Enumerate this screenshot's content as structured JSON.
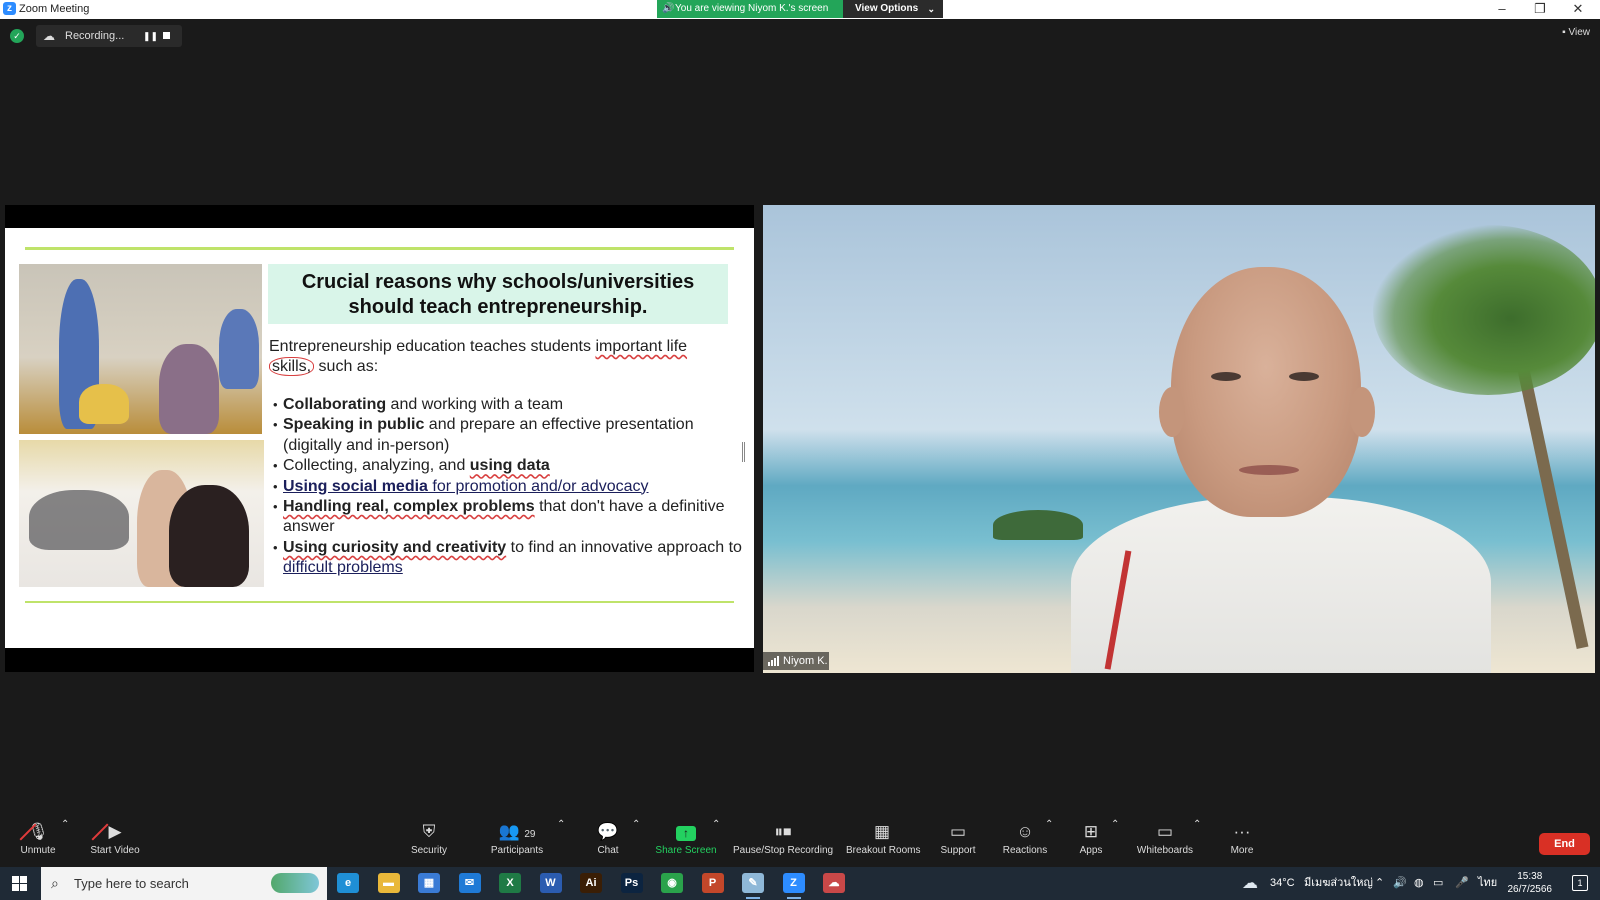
{
  "window": {
    "title": "Zoom Meeting",
    "viewing_banner": "You are viewing Niyom K.'s screen",
    "view_options": "View Options",
    "controls": {
      "minimize": "–",
      "restore": "❐",
      "close": "✕"
    }
  },
  "meeting_top": {
    "recording_label": "Recording...",
    "view_label": "View"
  },
  "slide": {
    "title": "Crucial reasons why schools/universities should teach entrepreneurship.",
    "intro_part1": "Entrepreneurship education teaches students ",
    "intro_highlight": "important life",
    "intro_skills": "skills,",
    "intro_part2": " such as:",
    "bullets": [
      {
        "bold": "Collaborating",
        "rest": " and working with a team"
      },
      {
        "bold": "Speaking in public",
        "rest": " and prepare an effective presentation (digitally and in-person)"
      },
      {
        "pre": "Collecting, analyzing, and ",
        "bold": "using data",
        "rest": ""
      },
      {
        "bold": "Using social media",
        "rest": " for promotion and/or advocacy"
      },
      {
        "bold": "Handling real, complex problems",
        "rest": " that don't have a definitive answer"
      },
      {
        "bold": "Using curiosity and creativity",
        "rest": " to find an innovative approach to ",
        "tail": "difficult problems"
      }
    ]
  },
  "video": {
    "participant_name": "Niyom K."
  },
  "toolbar": {
    "unmute": "Unmute",
    "start_video": "Start Video",
    "security": "Security",
    "participants": "Participants",
    "participants_count": "29",
    "chat": "Chat",
    "share_screen": "Share Screen",
    "pause_stop_recording": "Pause/Stop Recording",
    "breakout_rooms": "Breakout Rooms",
    "support": "Support",
    "reactions": "Reactions",
    "apps": "Apps",
    "whiteboards": "Whiteboards",
    "more": "More",
    "end": "End",
    "accent_green": "#23d160",
    "end_red": "#d93025"
  },
  "taskbar": {
    "search_placeholder": "Type here to search",
    "apps": [
      {
        "name": "edge-icon",
        "glyph": "e",
        "color": "#1f8fd6"
      },
      {
        "name": "file-explorer-icon",
        "glyph": "▬",
        "color": "#e9b83a"
      },
      {
        "name": "microsoft-store-icon",
        "glyph": "▦",
        "color": "#3a7bd5"
      },
      {
        "name": "mail-icon",
        "glyph": "✉",
        "color": "#1f7ad6"
      },
      {
        "name": "excel-icon",
        "glyph": "X",
        "color": "#1f7a45"
      },
      {
        "name": "word-icon",
        "glyph": "W",
        "color": "#2b5cb0"
      },
      {
        "name": "illustrator-icon",
        "glyph": "Ai",
        "color": "#3a1e05"
      },
      {
        "name": "photoshop-icon",
        "glyph": "Ps",
        "color": "#0c2440"
      },
      {
        "name": "chrome-icon",
        "glyph": "◉",
        "color": "#2aa24b"
      },
      {
        "name": "powerpoint-icon",
        "glyph": "P",
        "color": "#c3472a"
      },
      {
        "name": "notes-icon",
        "glyph": "✎",
        "color": "#8fb8d8"
      },
      {
        "name": "zoom-icon",
        "glyph": "Z",
        "color": "#2d8cff"
      },
      {
        "name": "zoom-recording-icon",
        "glyph": "☁",
        "color": "#c94848"
      }
    ],
    "weather_temp": "34°C",
    "weather_location": "มีเมฆส่วนใหญ่",
    "language": "ไทย",
    "time": "15:38",
    "date": "26/7/2566",
    "notification_count": "1"
  }
}
